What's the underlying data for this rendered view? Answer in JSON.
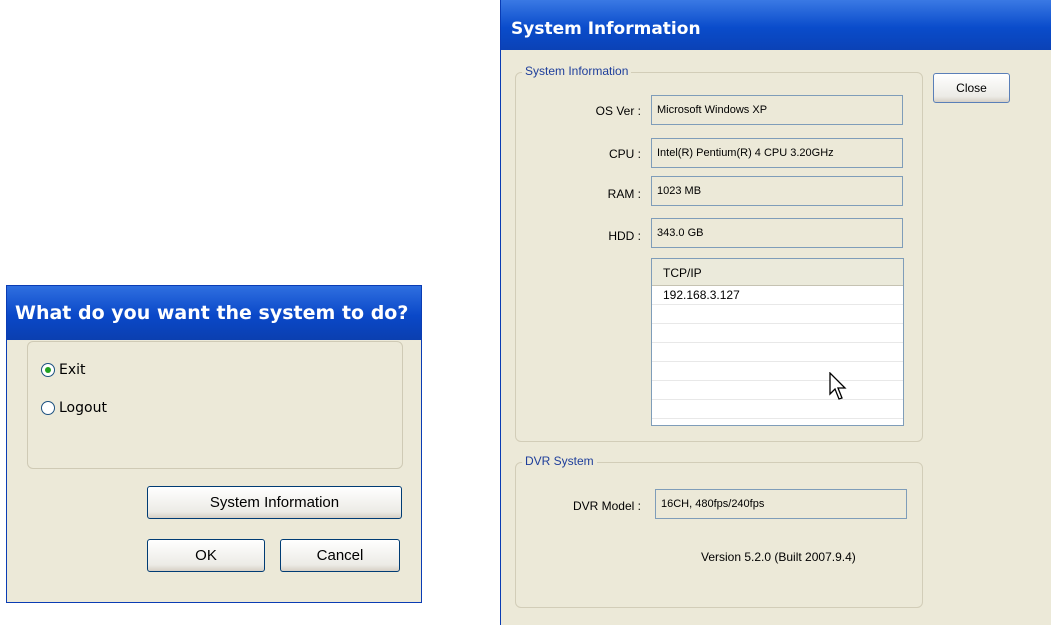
{
  "exit_dialog": {
    "title": "What do you want the system to do?",
    "options": [
      {
        "label": "Exit",
        "selected": true
      },
      {
        "label": "Logout",
        "selected": false
      }
    ],
    "system_info_button": "System Information",
    "ok_button": "OK",
    "cancel_button": "Cancel"
  },
  "sysinfo_window": {
    "title": "System Information",
    "close_button": "Close",
    "system_group": {
      "legend": "System Information",
      "fields": [
        {
          "label": "OS Ver :",
          "value": "Microsoft Windows XP"
        },
        {
          "label": "CPU :",
          "value": "Intel(R) Pentium(R) 4 CPU 3.20GHz"
        },
        {
          "label": "RAM :",
          "value": "1023 MB"
        },
        {
          "label": "HDD :",
          "value": "343.0 GB"
        }
      ],
      "network_list": {
        "header": "TCP/IP",
        "rows": [
          "192.168.3.127",
          "",
          "",
          "",
          "",
          "",
          ""
        ]
      }
    },
    "dvr_group": {
      "legend": "DVR System",
      "model_label": "DVR Model :",
      "model_value": "16CH, 480fps/240fps",
      "version": "Version 5.2.0 (Built 2007.9.4)"
    }
  },
  "colors": {
    "titlebar": "#0a48c8",
    "dialog_bg": "#ece9d8",
    "legend_text": "#1e3e9b"
  }
}
